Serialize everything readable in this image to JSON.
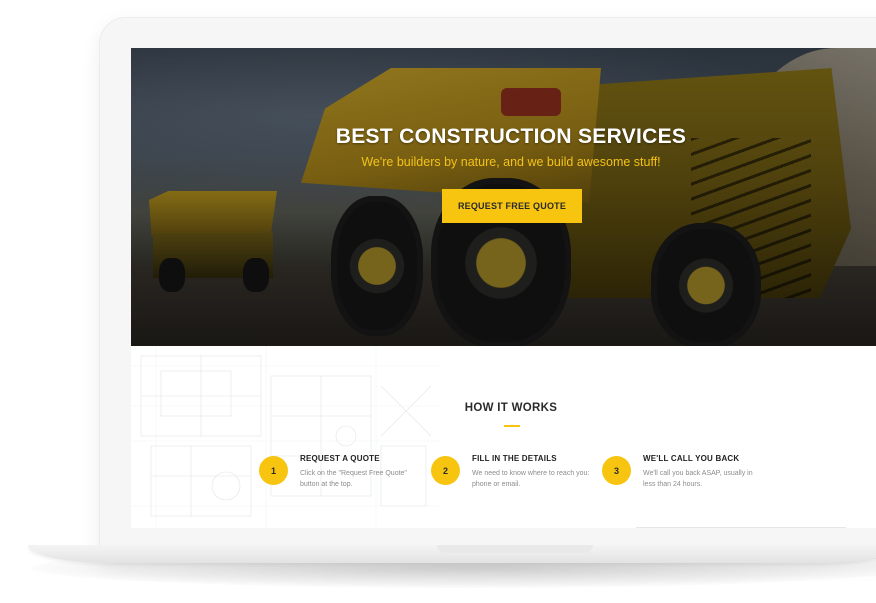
{
  "hero": {
    "title": "BEST CONSTRUCTION SERVICES",
    "subtitle": "We're builders by nature, and we build awesome stuff!",
    "cta_label": "REQUEST FREE QUOTE"
  },
  "how_it_works": {
    "title": "HOW IT WORKS",
    "steps": [
      {
        "number": "1",
        "title": "REQUEST A QUOTE",
        "description": "Click on the \"Request Free Quote\" button at the top."
      },
      {
        "number": "2",
        "title": "FILL IN THE DETAILS",
        "description": "We need to know where to reach you: phone or email."
      },
      {
        "number": "3",
        "title": "WE'LL CALL YOU BACK",
        "description": "We'll call you back ASAP, usually in less than 24 hours."
      }
    ]
  },
  "colors": {
    "accent": "#f7c50f",
    "heading": "#2b2b2b",
    "muted_text": "#8c8c8c"
  }
}
